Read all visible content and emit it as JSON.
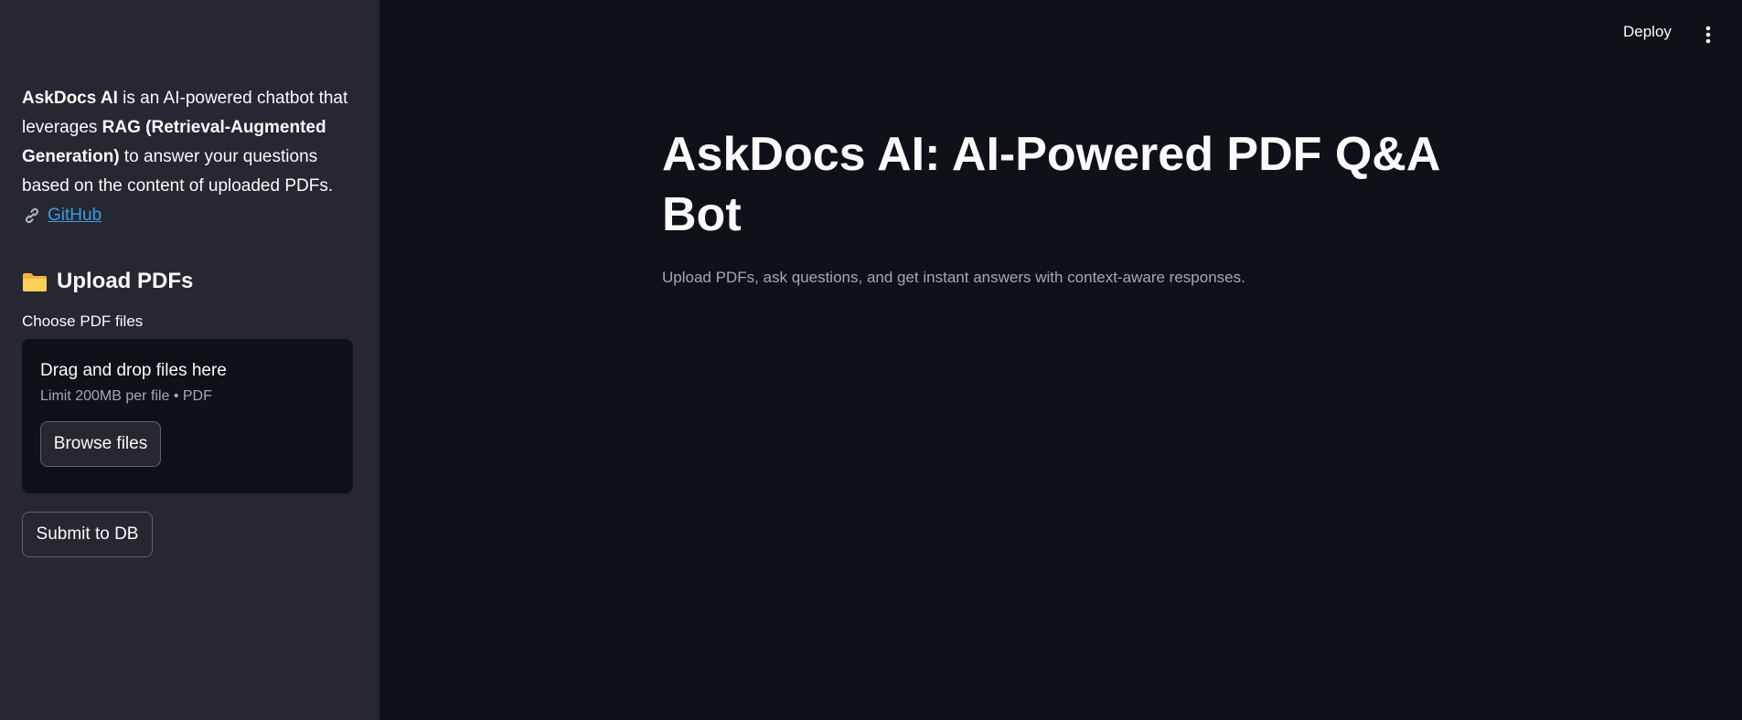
{
  "header": {
    "deploy_label": "Deploy",
    "menu_icon": "vertical-ellipsis-icon"
  },
  "sidebar": {
    "about": {
      "app_name": "AskDocs AI",
      "text_1": " is an AI-powered chatbot that leverages ",
      "rag_bold": "RAG (Retrieval-Augmented Generation)",
      "text_2": " to answer your questions based on the content of uploaded PDFs.",
      "link_icon": "link-icon",
      "github_label": "GitHub"
    },
    "upload": {
      "heading_icon": "folder-icon",
      "heading": "Upload PDFs",
      "choose_label": "Choose PDF files",
      "dropzone_title": "Drag and drop files here",
      "dropzone_limit": "Limit 200MB per file • PDF",
      "browse_label": "Browse files"
    },
    "submit_label": "Submit to DB"
  },
  "main": {
    "title": "AskDocs AI: AI-Powered PDF Q&A Bot",
    "subtitle": "Upload PDFs, ask questions, and get instant answers with context-aware responses."
  },
  "colors": {
    "background": "#0e1117",
    "sidebar": "#262730",
    "link": "#3b9ae8",
    "muted_text": "#a3a8b4"
  }
}
